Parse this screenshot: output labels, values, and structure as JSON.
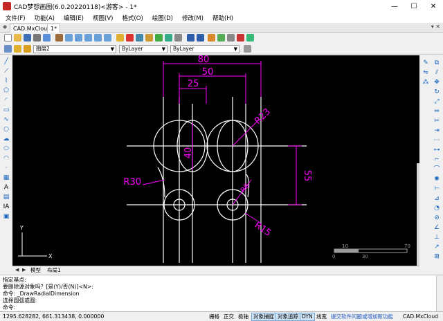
{
  "window": {
    "title": "CAD梦想画图(6.0.20220118)<游客> - 1*",
    "minimize": "—",
    "maximize": "☐",
    "close": "✕"
  },
  "menu": [
    "文件(F)",
    "功能(A)",
    "编辑(E)",
    "视图(V)",
    "格式(O)",
    "绘图(D)",
    "修改(M)",
    "帮助(H)"
  ],
  "doc_tabs": {
    "pin": "◆",
    "tab_a": "CAD.MxCloud",
    "tab_b": "1*",
    "right_controls": "▾ ✕"
  },
  "properties": {
    "layer": "图层2",
    "color": "ByLayer",
    "linetype": "ByLayer"
  },
  "drawing": {
    "dim_80": "80",
    "dim_50": "50",
    "dim_25": "25",
    "dim_40": "40",
    "dim_55": "55",
    "dim_r23": "R23",
    "dim_r30": "R30",
    "dim_r8": "R8",
    "dim_r15": "R15",
    "ucs_y": "Y",
    "ucs_x": "X",
    "scale_10": "10",
    "scale_70": "70",
    "scale_0": "0",
    "scale_30": "30",
    "line_color": "#ffffff",
    "dim_color": "#ff00ff",
    "background": "#000000"
  },
  "layout_tabs": {
    "nav_first": "◀",
    "nav_next": "▶",
    "model": "模型",
    "layout1": "布局1"
  },
  "command_history": [
    "指定基点:",
    "要删除源对象吗？[是(Y)/否(N)]<N>:",
    "命令:  _DrawRadialDimension",
    "  选择圆弧或圆:",
    "命令:"
  ],
  "status": {
    "coords": "1295.628282,  661.313438,  0.000000",
    "grid": "栅格",
    "ortho": "正交",
    "polar": "极轴",
    "osnap": "对象捕捉",
    "otrack": "对象追踪",
    "dyn": "DYN",
    "lweight": "线宽",
    "link": "提交软件问题或增加新功能",
    "brand": "CAD.MxCloud"
  }
}
